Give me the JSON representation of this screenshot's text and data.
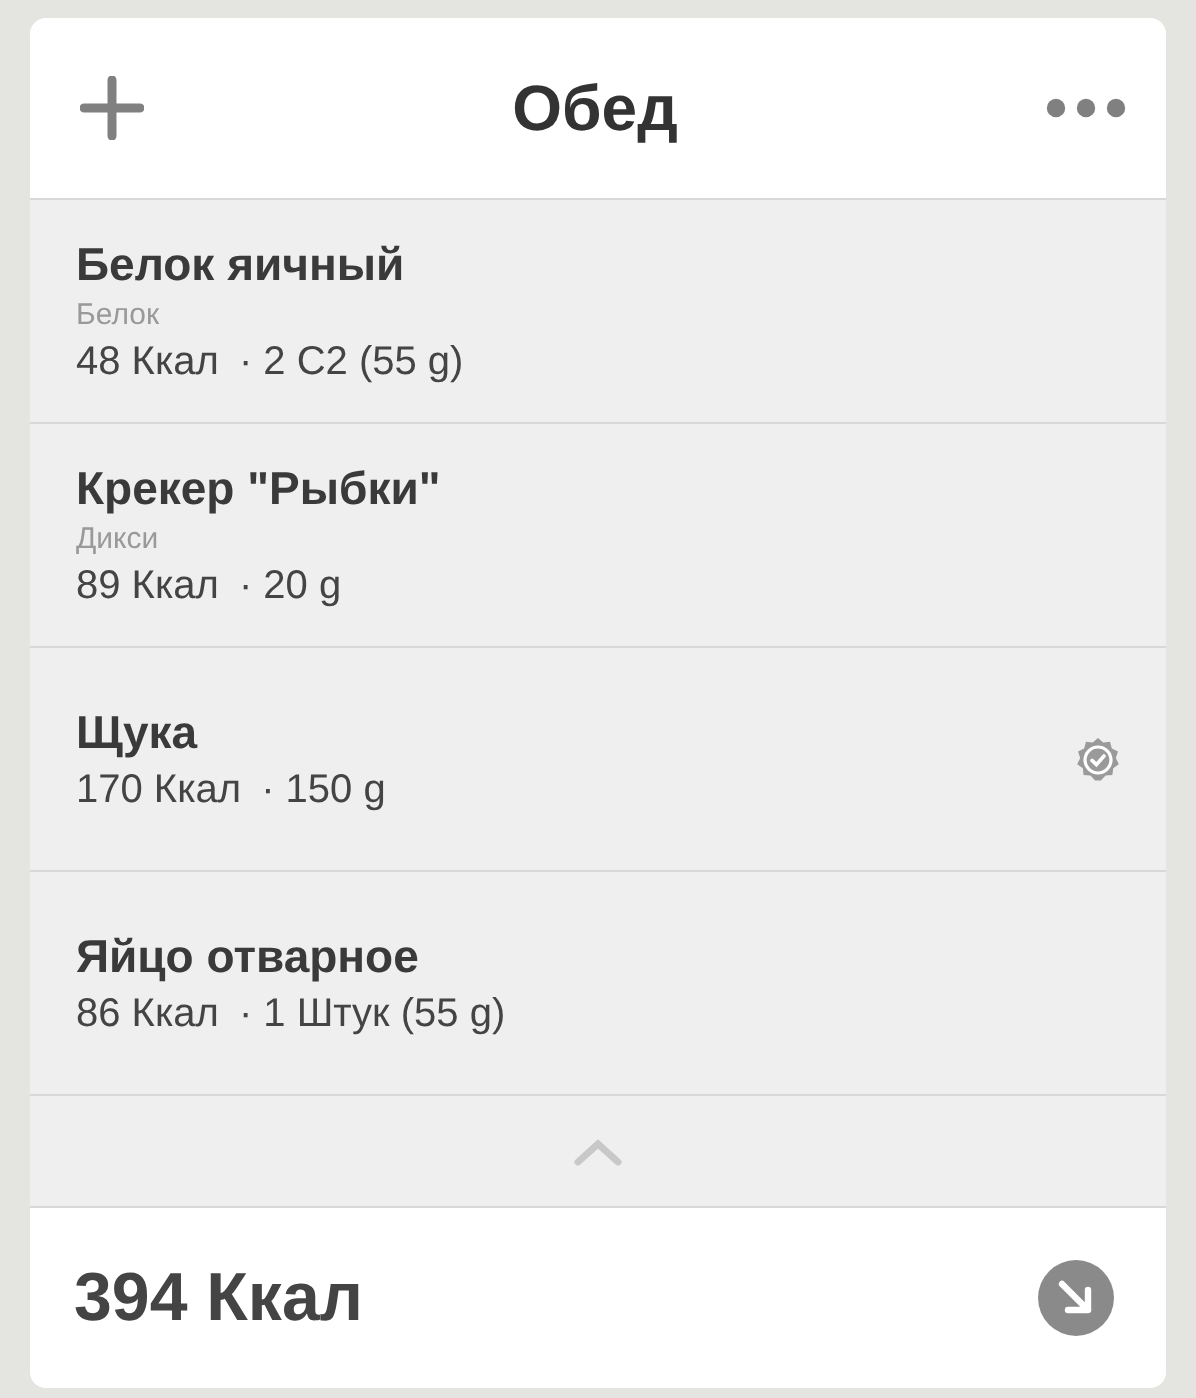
{
  "header": {
    "title": "Обед"
  },
  "items": [
    {
      "name": "Белок яичный",
      "brand": "Белок",
      "calories": "48 Ккал",
      "portion": "· 2 С2 (55 g)",
      "verified": false
    },
    {
      "name": "Крекер \"Рыбки\"",
      "brand": "Дикси",
      "calories": "89 Ккал",
      "portion": "· 20 g",
      "verified": false
    },
    {
      "name": "Щука",
      "calories": "170 Ккал",
      "portion": "· 150 g",
      "verified": true
    },
    {
      "name": "Яйцо отварное",
      "calories": "86 Ккал",
      "portion": "· 1 Штук (55 g)",
      "verified": false
    }
  ],
  "footer": {
    "total": "394 Ккал"
  }
}
